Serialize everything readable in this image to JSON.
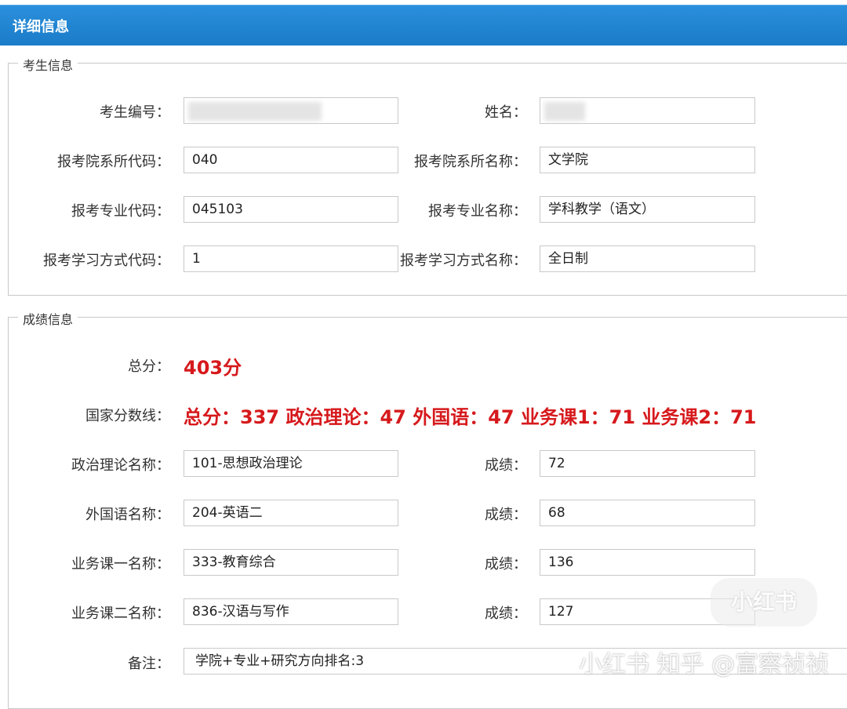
{
  "window": {
    "title": "详细信息"
  },
  "candidate": {
    "legend": "考生信息",
    "fields": [
      {
        "label": "考生编号：",
        "value": ""
      },
      {
        "label": "姓名：",
        "value": ""
      },
      {
        "label": "报考院系所代码：",
        "value": "040"
      },
      {
        "label": "报考院系所名称：",
        "value": "文学院"
      },
      {
        "label": "报考专业代码：",
        "value": "045103"
      },
      {
        "label": "报考专业名称：",
        "value": "学科教学（语文）"
      },
      {
        "label": "报考学习方式代码：",
        "value": "1"
      },
      {
        "label": "报考学习方式名称：",
        "value": "全日制"
      }
    ]
  },
  "scores": {
    "legend": "成绩信息",
    "total_label": "总分：",
    "total_value": "403分",
    "national_label": "国家分数线：",
    "national_value": "总分：337 政治理论：47 外国语：47 业务课1：71 业务课2：71",
    "subjects": [
      {
        "label": "政治理论名称：",
        "name": "101-思想政治理论",
        "score_label": "成绩：",
        "score": "72"
      },
      {
        "label": "外国语名称：",
        "name": "204-英语二",
        "score_label": "成绩：",
        "score": "68"
      },
      {
        "label": "业务课一名称：",
        "name": "333-教育综合",
        "score_label": "成绩：",
        "score": "136"
      },
      {
        "label": "业务课二名称：",
        "name": "836-汉语与写作",
        "score_label": "成绩：",
        "score": "127"
      }
    ],
    "remark_label": "备注：",
    "remark_value": "学院+专业+研究方向排名:3"
  },
  "watermark": {
    "logo_text": "小红书",
    "credit_text": "小红书 知乎 @富察祯祯"
  },
  "colors": {
    "header": "#1b7cc9",
    "highlight": "#d6191c"
  }
}
